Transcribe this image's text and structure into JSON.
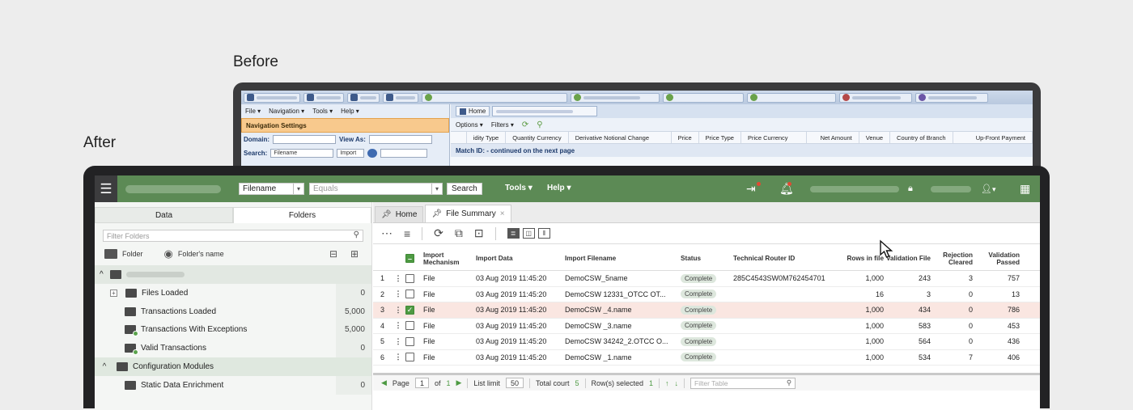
{
  "captions": {
    "before": "Before",
    "after": "After"
  },
  "before": {
    "menu": [
      "File ▾",
      "Navigation ▾",
      "Tools ▾",
      "Help ▾"
    ],
    "nav_settings": "Navigation Settings",
    "domain_label": "Domain:",
    "view_as_label": "View As:",
    "search_label": "Search:",
    "search_select": "Filename",
    "import_btn": "Import",
    "home_tab": "Home",
    "options": "Options ▾",
    "filters": "Filters ▾",
    "columns": [
      "idity Type",
      "Quantity Currency",
      "Derivative Notional Change",
      "Price",
      "Price Type",
      "Price Currency",
      "Net Amount",
      "Venue",
      "Country of Branch",
      "Up-Front Payment"
    ],
    "group_row": "Match ID: - continued on the next page"
  },
  "after": {
    "search_select": "Filename",
    "operator_select": "Equals",
    "search_button": "Search",
    "menu_tools": "Tools ▾",
    "menu_help": "Help ▾",
    "user_menu": "▾",
    "left_tabs": [
      "Data",
      "Folders"
    ],
    "filter_placeholder": "Filter Folders",
    "folder_action": "Folder",
    "folders_name_action": "Folder's name",
    "tree": [
      {
        "label": "Files Loaded",
        "count": "0"
      },
      {
        "label": "Transactions Loaded",
        "count": "5,000"
      },
      {
        "label": "Transactions With Exceptions",
        "count": "5,000"
      },
      {
        "label": "Valid Transactions",
        "count": "0"
      },
      {
        "label": "Configuration Modules",
        "count": ""
      },
      {
        "label": "Static Data Enrichment",
        "count": "0"
      }
    ],
    "tabs": [
      {
        "label": "Home"
      },
      {
        "label": "File Summary"
      }
    ],
    "columns": {
      "mech": "Import Mechanism",
      "date": "Import Data",
      "file": "Import Filename",
      "status": "Status",
      "rid": "Technical Router ID",
      "rows": "Rows in file",
      "vf": "Validation File",
      "rc": "Rejection Cleared",
      "vp": "Validation Passed"
    },
    "rows": [
      {
        "n": "1",
        "mech": "File",
        "date": "03 Aug 2019 11:45:20",
        "file": "DemoCSW_5name",
        "status": "Complete",
        "rid": "285C4543SW0M762454701",
        "rows": "1,000",
        "vf": "243",
        "rc": "3",
        "vp": "757"
      },
      {
        "n": "2",
        "mech": "File",
        "date": "03 Aug 2019 11:45:20",
        "file": "DemoCSW 12331_OTCC OT...",
        "status": "Complete",
        "rid": "",
        "rows": "16",
        "vf": "3",
        "rc": "0",
        "vp": "13"
      },
      {
        "n": "3",
        "mech": "File",
        "date": "03 Aug 2019 11:45:20",
        "file": "DemoCSW _4.name",
        "status": "Complete",
        "rid": "",
        "rows": "1,000",
        "vf": "434",
        "rc": "0",
        "vp": "786"
      },
      {
        "n": "4",
        "mech": "File",
        "date": "03 Aug 2019 11:45:20",
        "file": "DemoCSW _3.name",
        "status": "Complete",
        "rid": "",
        "rows": "1,000",
        "vf": "583",
        "rc": "0",
        "vp": "453"
      },
      {
        "n": "5",
        "mech": "File",
        "date": "03 Aug 2019 11:45:20",
        "file": "DemoCSW 34242_2.OTCC O...",
        "status": "Complete",
        "rid": "",
        "rows": "1,000",
        "vf": "564",
        "rc": "0",
        "vp": "436"
      },
      {
        "n": "6",
        "mech": "File",
        "date": "03 Aug 2019 11:45:20",
        "file": "DemoCSW _1.name",
        "status": "Complete",
        "rid": "",
        "rows": "1,000",
        "vf": "534",
        "rc": "7",
        "vp": "406"
      }
    ],
    "pager": {
      "page_label": "Page",
      "page_value": "1",
      "of_label": "of",
      "of_value": "1",
      "limit_label": "List limit",
      "limit_value": "50",
      "total_label": "Total court",
      "total_value": "5",
      "selected_label": "Row(s) selected",
      "selected_value": "1",
      "filter_placeholder": "Filter Table"
    }
  }
}
